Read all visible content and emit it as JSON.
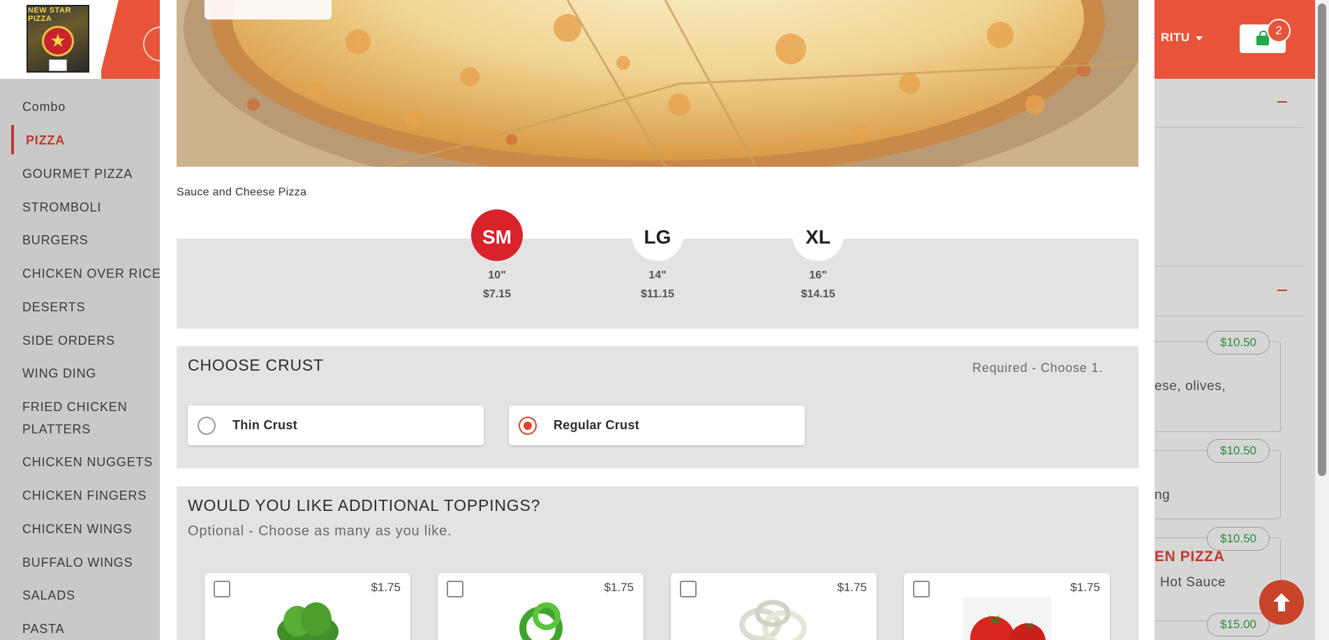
{
  "header": {
    "logo_text": "NEW STAR PIZZA",
    "user_label": "RITU",
    "cart_count": "2"
  },
  "sidebar": {
    "items": [
      {
        "label": "Combo",
        "active": false
      },
      {
        "label": "PIZZA",
        "active": true
      },
      {
        "label": "GOURMET PIZZA",
        "active": false
      },
      {
        "label": "STROMBOLI",
        "active": false
      },
      {
        "label": "BURGERS",
        "active": false
      },
      {
        "label": "CHICKEN OVER RICE",
        "active": false
      },
      {
        "label": "DESERTS",
        "active": false
      },
      {
        "label": "SIDE ORDERS",
        "active": false
      },
      {
        "label": "WING DING",
        "active": false
      },
      {
        "label": "FRIED CHICKEN PLATTERS",
        "active": false
      },
      {
        "label": "CHICKEN NUGGETS",
        "active": false
      },
      {
        "label": "CHICKEN FINGERS",
        "active": false
      },
      {
        "label": "CHICKEN WINGS",
        "active": false
      },
      {
        "label": "BUFFALO WINGS",
        "active": false
      },
      {
        "label": "SALADS",
        "active": false
      },
      {
        "label": "PASTA",
        "active": false
      }
    ]
  },
  "background_menu": {
    "prices": [
      "$10.50",
      "$10.50",
      "$10.50",
      "$15.00"
    ],
    "texts": [
      "ese, olives,",
      "ng",
      "Hot Sauce"
    ],
    "title": "EN PIZZA"
  },
  "modal": {
    "description": "Sauce and Cheese Pizza",
    "sizes": [
      {
        "code": "SM",
        "inches": "10\"",
        "price": "$7.15",
        "selected": true
      },
      {
        "code": "LG",
        "inches": "14\"",
        "price": "$11.15",
        "selected": false
      },
      {
        "code": "XL",
        "inches": "16\"",
        "price": "$14.15",
        "selected": false
      }
    ],
    "crust": {
      "title": "CHOOSE CRUST",
      "note": "Required - Choose 1.",
      "options": [
        {
          "label": "Thin Crust",
          "selected": false
        },
        {
          "label": "Regular Crust",
          "selected": true
        }
      ]
    },
    "toppings": {
      "title": "WOULD YOU LIKE ADDITIONAL TOPPINGS?",
      "note": "Optional - Choose as many as you like.",
      "items": [
        {
          "price": "$1.75",
          "icon": "spinach-icon"
        },
        {
          "price": "$1.75",
          "icon": "green-pepper-icon"
        },
        {
          "price": "$1.75",
          "icon": "onion-icon"
        },
        {
          "price": "$1.75",
          "icon": "tomato-icon"
        }
      ]
    }
  },
  "colors": {
    "brand": "#e8543a",
    "accent_red": "#d8232a",
    "price_green": "#2e8b3e"
  }
}
